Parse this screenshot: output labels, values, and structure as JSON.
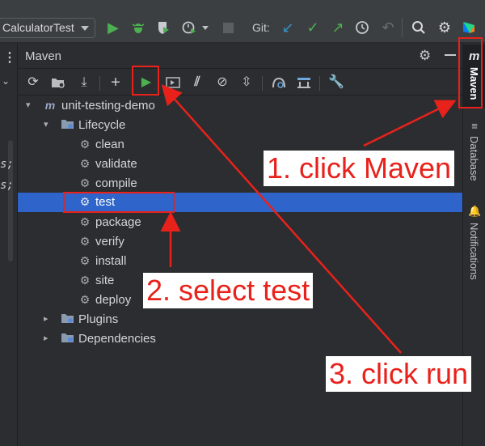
{
  "toolbar": {
    "run_config": "CalculatorTest",
    "git_label": "Git:",
    "colors": {
      "green": "#4caf50",
      "blue": "#3592c4",
      "bg": "#3c3f41"
    }
  },
  "editor_fragment": {
    "line1": "s;",
    "line2": "s;"
  },
  "maven_panel": {
    "title": "Maven",
    "toolbar_icons": [
      "reload-icon",
      "generate-sources-icon",
      "download-icon",
      "add-icon",
      "run-icon",
      "execute-goal-icon",
      "skip-tests-icon",
      "offline-icon",
      "collapse-icon",
      "analyze-dependencies-icon",
      "show-dependencies-icon",
      "settings-wrench-icon"
    ]
  },
  "tree": {
    "project": "unit-testing-demo",
    "lifecycle": "Lifecycle",
    "goals": [
      "clean",
      "validate",
      "compile",
      "test",
      "package",
      "verify",
      "install",
      "site",
      "deploy"
    ],
    "selected_goal": "test",
    "plugins": "Plugins",
    "dependencies": "Dependencies"
  },
  "right_tabs": {
    "maven": "Maven",
    "database": "Database",
    "notifications": "Notifications"
  },
  "annotations": {
    "step1": "1. click Maven",
    "step2": "2. select test",
    "step3": "3. click run",
    "color": "#e8221b"
  }
}
